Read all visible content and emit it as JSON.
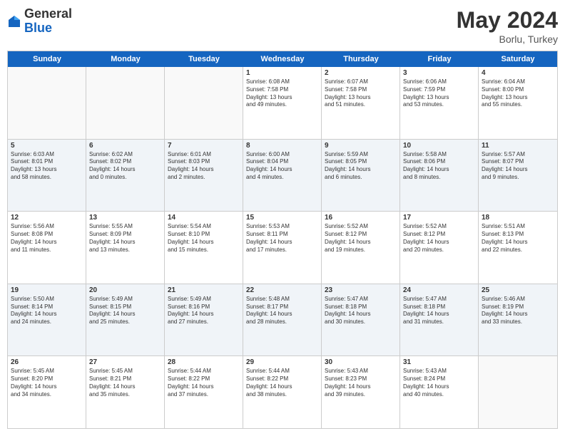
{
  "header": {
    "logo_general": "General",
    "logo_blue": "Blue",
    "month_title": "May 2024",
    "location": "Borlu, Turkey"
  },
  "days_of_week": [
    "Sunday",
    "Monday",
    "Tuesday",
    "Wednesday",
    "Thursday",
    "Friday",
    "Saturday"
  ],
  "rows": [
    [
      {
        "day": "",
        "empty": true
      },
      {
        "day": "",
        "empty": true
      },
      {
        "day": "",
        "empty": true
      },
      {
        "day": "1",
        "lines": [
          "Sunrise: 6:08 AM",
          "Sunset: 7:58 PM",
          "Daylight: 13 hours",
          "and 49 minutes."
        ]
      },
      {
        "day": "2",
        "lines": [
          "Sunrise: 6:07 AM",
          "Sunset: 7:58 PM",
          "Daylight: 13 hours",
          "and 51 minutes."
        ]
      },
      {
        "day": "3",
        "lines": [
          "Sunrise: 6:06 AM",
          "Sunset: 7:59 PM",
          "Daylight: 13 hours",
          "and 53 minutes."
        ]
      },
      {
        "day": "4",
        "lines": [
          "Sunrise: 6:04 AM",
          "Sunset: 8:00 PM",
          "Daylight: 13 hours",
          "and 55 minutes."
        ]
      }
    ],
    [
      {
        "day": "5",
        "lines": [
          "Sunrise: 6:03 AM",
          "Sunset: 8:01 PM",
          "Daylight: 13 hours",
          "and 58 minutes."
        ]
      },
      {
        "day": "6",
        "lines": [
          "Sunrise: 6:02 AM",
          "Sunset: 8:02 PM",
          "Daylight: 14 hours",
          "and 0 minutes."
        ]
      },
      {
        "day": "7",
        "lines": [
          "Sunrise: 6:01 AM",
          "Sunset: 8:03 PM",
          "Daylight: 14 hours",
          "and 2 minutes."
        ]
      },
      {
        "day": "8",
        "lines": [
          "Sunrise: 6:00 AM",
          "Sunset: 8:04 PM",
          "Daylight: 14 hours",
          "and 4 minutes."
        ]
      },
      {
        "day": "9",
        "lines": [
          "Sunrise: 5:59 AM",
          "Sunset: 8:05 PM",
          "Daylight: 14 hours",
          "and 6 minutes."
        ]
      },
      {
        "day": "10",
        "lines": [
          "Sunrise: 5:58 AM",
          "Sunset: 8:06 PM",
          "Daylight: 14 hours",
          "and 8 minutes."
        ]
      },
      {
        "day": "11",
        "lines": [
          "Sunrise: 5:57 AM",
          "Sunset: 8:07 PM",
          "Daylight: 14 hours",
          "and 9 minutes."
        ]
      }
    ],
    [
      {
        "day": "12",
        "lines": [
          "Sunrise: 5:56 AM",
          "Sunset: 8:08 PM",
          "Daylight: 14 hours",
          "and 11 minutes."
        ]
      },
      {
        "day": "13",
        "lines": [
          "Sunrise: 5:55 AM",
          "Sunset: 8:09 PM",
          "Daylight: 14 hours",
          "and 13 minutes."
        ]
      },
      {
        "day": "14",
        "lines": [
          "Sunrise: 5:54 AM",
          "Sunset: 8:10 PM",
          "Daylight: 14 hours",
          "and 15 minutes."
        ]
      },
      {
        "day": "15",
        "lines": [
          "Sunrise: 5:53 AM",
          "Sunset: 8:11 PM",
          "Daylight: 14 hours",
          "and 17 minutes."
        ]
      },
      {
        "day": "16",
        "lines": [
          "Sunrise: 5:52 AM",
          "Sunset: 8:12 PM",
          "Daylight: 14 hours",
          "and 19 minutes."
        ]
      },
      {
        "day": "17",
        "lines": [
          "Sunrise: 5:52 AM",
          "Sunset: 8:12 PM",
          "Daylight: 14 hours",
          "and 20 minutes."
        ]
      },
      {
        "day": "18",
        "lines": [
          "Sunrise: 5:51 AM",
          "Sunset: 8:13 PM",
          "Daylight: 14 hours",
          "and 22 minutes."
        ]
      }
    ],
    [
      {
        "day": "19",
        "lines": [
          "Sunrise: 5:50 AM",
          "Sunset: 8:14 PM",
          "Daylight: 14 hours",
          "and 24 minutes."
        ]
      },
      {
        "day": "20",
        "lines": [
          "Sunrise: 5:49 AM",
          "Sunset: 8:15 PM",
          "Daylight: 14 hours",
          "and 25 minutes."
        ]
      },
      {
        "day": "21",
        "lines": [
          "Sunrise: 5:49 AM",
          "Sunset: 8:16 PM",
          "Daylight: 14 hours",
          "and 27 minutes."
        ]
      },
      {
        "day": "22",
        "lines": [
          "Sunrise: 5:48 AM",
          "Sunset: 8:17 PM",
          "Daylight: 14 hours",
          "and 28 minutes."
        ]
      },
      {
        "day": "23",
        "lines": [
          "Sunrise: 5:47 AM",
          "Sunset: 8:18 PM",
          "Daylight: 14 hours",
          "and 30 minutes."
        ]
      },
      {
        "day": "24",
        "lines": [
          "Sunrise: 5:47 AM",
          "Sunset: 8:18 PM",
          "Daylight: 14 hours",
          "and 31 minutes."
        ]
      },
      {
        "day": "25",
        "lines": [
          "Sunrise: 5:46 AM",
          "Sunset: 8:19 PM",
          "Daylight: 14 hours",
          "and 33 minutes."
        ]
      }
    ],
    [
      {
        "day": "26",
        "lines": [
          "Sunrise: 5:45 AM",
          "Sunset: 8:20 PM",
          "Daylight: 14 hours",
          "and 34 minutes."
        ]
      },
      {
        "day": "27",
        "lines": [
          "Sunrise: 5:45 AM",
          "Sunset: 8:21 PM",
          "Daylight: 14 hours",
          "and 35 minutes."
        ]
      },
      {
        "day": "28",
        "lines": [
          "Sunrise: 5:44 AM",
          "Sunset: 8:22 PM",
          "Daylight: 14 hours",
          "and 37 minutes."
        ]
      },
      {
        "day": "29",
        "lines": [
          "Sunrise: 5:44 AM",
          "Sunset: 8:22 PM",
          "Daylight: 14 hours",
          "and 38 minutes."
        ]
      },
      {
        "day": "30",
        "lines": [
          "Sunrise: 5:43 AM",
          "Sunset: 8:23 PM",
          "Daylight: 14 hours",
          "and 39 minutes."
        ]
      },
      {
        "day": "31",
        "lines": [
          "Sunrise: 5:43 AM",
          "Sunset: 8:24 PM",
          "Daylight: 14 hours",
          "and 40 minutes."
        ]
      },
      {
        "day": "",
        "empty": true
      }
    ]
  ]
}
